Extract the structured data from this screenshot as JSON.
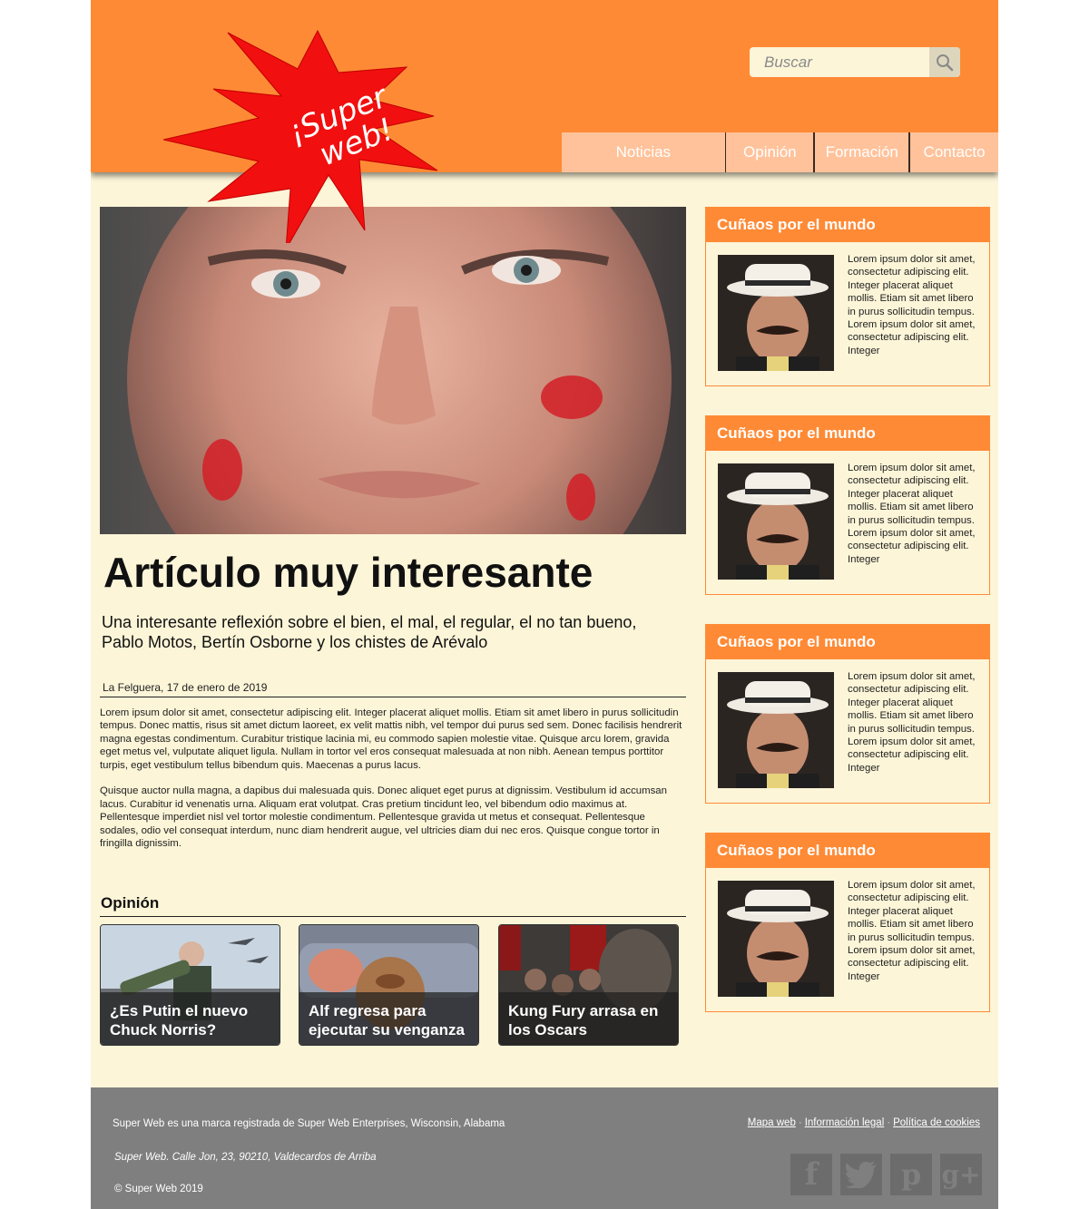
{
  "header": {
    "logo_text": "¡Super web!",
    "search": {
      "placeholder": "Buscar"
    },
    "nav": [
      {
        "label": "Noticias"
      },
      {
        "label": "Opinión"
      },
      {
        "label": "Formación"
      },
      {
        "label": "Contacto"
      }
    ]
  },
  "article": {
    "title": "Artículo muy interesante",
    "subtitle": "Una interesante reflexión sobre el bien, el mal, el regular, el no tan bueno, Pablo Motos, Bertín Osborne y los chistes de Arévalo",
    "meta": "La Felguera, 17 de enero de 2019",
    "paragraphs": [
      " Lorem ipsum dolor sit amet, consectetur adipiscing elit. Integer placerat aliquet mollis. Etiam sit amet libero in purus sollicitudin tempus. Donec mattis, risus sit amet dictum laoreet, ex velit mattis nibh, vel tempor dui purus sed sem. Donec facilisis hendrerit magna egestas condimentum. Curabitur tristique lacinia mi, eu commodo sapien molestie vitae. Quisque arcu lorem, gravida eget metus vel, vulputate aliquet ligula. Nullam in tortor vel eros consequat malesuada at non nibh. Aenean tempus porttitor turpis, eget vestibulum tellus bibendum quis. Maecenas a purus lacus.",
      "Quisque auctor nulla magna, a dapibus dui malesuada quis. Donec aliquet eget purus at dignissim. Vestibulum id accumsan lacus. Curabitur id venenatis urna. Aliquam erat volutpat. Cras pretium tincidunt leo, vel bibendum odio maximus at. Pellentesque imperdiet nisl vel tortor molestie condimentum. Pellentesque gravida ut metus et consequat. Pellentesque sodales, odio vel consequat interdum, nunc diam hendrerit augue, vel ultricies diam dui nec eros. Quisque congue tortor in fringilla dignissim."
    ]
  },
  "opinion": {
    "heading": "Opinión",
    "cards": [
      {
        "title": "¿Es Putin el nuevo Chuck Norris?"
      },
      {
        "title": "Alf regresa para ejecutar su venganza"
      },
      {
        "title": "Kung Fury arrasa en los Oscars"
      }
    ]
  },
  "sidebar": {
    "boxes": [
      {
        "title": "Cuñaos por el mundo",
        "text": "Lorem ipsum dolor sit amet, consectetur adipiscing elit. Integer placerat aliquet mollis. Etiam sit amet libero in purus sollicitudin tempus. Lorem ipsum dolor sit amet, consectetur adipiscing elit. Integer"
      },
      {
        "title": "Cuñaos por el mundo",
        "text": "Lorem ipsum dolor sit amet, consectetur adipiscing elit. Integer placerat aliquet mollis. Etiam sit amet libero in purus sollicitudin tempus. Lorem ipsum dolor sit amet, consectetur adipiscing elit. Integer"
      },
      {
        "title": "Cuñaos por el mundo",
        "text": "Lorem ipsum dolor sit amet, consectetur adipiscing elit. Integer placerat aliquet mollis. Etiam sit amet libero in purus sollicitudin tempus. Lorem ipsum dolor sit amet, consectetur adipiscing elit. Integer"
      },
      {
        "title": "Cuñaos por el mundo",
        "text": "Lorem ipsum dolor sit amet, consectetur adipiscing elit. Integer placerat aliquet mollis. Etiam sit amet libero in purus sollicitudin tempus. Lorem ipsum dolor sit amet, consectetur adipiscing elit. Integer"
      }
    ]
  },
  "footer": {
    "registered": "Super Web es una marca registrada de Super Web Enterprises, Wisconsin, Alabama",
    "address": "Super Web. Calle Jon, 23, 90210, Valdecardos de Arriba",
    "copyright": "© Super Web 2019",
    "links": [
      {
        "label": "Mapa web"
      },
      {
        "label": "Información legal"
      },
      {
        "label": "Política de cookies"
      }
    ],
    "link_separator": "·",
    "social": [
      {
        "icon": "facebook-icon",
        "glyph": "f"
      },
      {
        "icon": "twitter-icon",
        "glyph": "t"
      },
      {
        "icon": "pinterest-icon",
        "glyph": "p"
      },
      {
        "icon": "google-plus-icon",
        "glyph": "g+"
      }
    ]
  },
  "colors": {
    "header_orange": "#ff8a35",
    "nav_peach": "#ffc29a",
    "page_cream": "#fcf5d8",
    "footer_gray": "#7f7f7f",
    "logo_red": "#f20f0f"
  }
}
